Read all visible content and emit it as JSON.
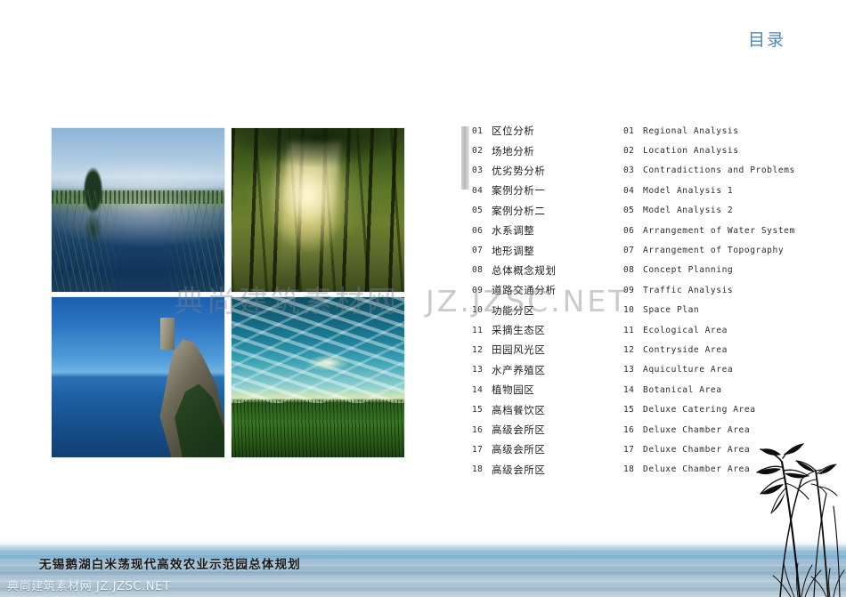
{
  "page": {
    "title_cn": "目录",
    "title_color": "#4e86b4",
    "footer_title": "无锡鹅湖白米荡现代高效农业示范园总体规划"
  },
  "watermark": {
    "center_left": "典尚建筑素材网",
    "center_right": "JZ.JZSC.NET",
    "bottom": "典尚建筑素材网  JZ.JZSC.NET"
  },
  "images": [
    {
      "name": "wetland-pond-photo",
      "caption": "wetland pond at dawn"
    },
    {
      "name": "sunlit-forest-photo",
      "caption": "sunlit forest path"
    },
    {
      "name": "sea-cliff-tower-photo",
      "caption": "sea cliff with stone tower"
    },
    {
      "name": "meadow-sunset-photo",
      "caption": "meadow under dramatic sunset sky"
    }
  ],
  "contents": {
    "chinese": [
      {
        "num": "01",
        "label": "区位分析"
      },
      {
        "num": "02",
        "label": "场地分析"
      },
      {
        "num": "03",
        "label": "优劣势分析"
      },
      {
        "num": "04",
        "label": "案例分析一"
      },
      {
        "num": "05",
        "label": "案例分析二"
      },
      {
        "num": "06",
        "label": "水系调整"
      },
      {
        "num": "07",
        "label": "地形调整"
      },
      {
        "num": "08",
        "label": "总体概念规划"
      },
      {
        "num": "09",
        "label": "道路交通分析"
      },
      {
        "num": "10",
        "label": "功能分区"
      },
      {
        "num": "11",
        "label": "采摘生态区"
      },
      {
        "num": "12",
        "label": "田园风光区"
      },
      {
        "num": "13",
        "label": "水产养殖区"
      },
      {
        "num": "14",
        "label": "植物园区"
      },
      {
        "num": "15",
        "label": "高档餐饮区"
      },
      {
        "num": "16",
        "label": "高级会所区"
      },
      {
        "num": "17",
        "label": "高级会所区"
      },
      {
        "num": "18",
        "label": "高级会所区"
      }
    ],
    "english": [
      {
        "num": "01",
        "label": "Regional Analysis"
      },
      {
        "num": "02",
        "label": "Location Analysis"
      },
      {
        "num": "03",
        "label": "Contradictions and Problems"
      },
      {
        "num": "04",
        "label": "Model Analysis 1"
      },
      {
        "num": "05",
        "label": "Model Analysis 2"
      },
      {
        "num": "06",
        "label": "Arrangement of Water System"
      },
      {
        "num": "07",
        "label": "Arrangement of Topography"
      },
      {
        "num": "08",
        "label": "Concept Planning"
      },
      {
        "num": "09",
        "label": "Traffic Analysis"
      },
      {
        "num": "10",
        "label": "Space Plan"
      },
      {
        "num": "11",
        "label": "Ecological Area"
      },
      {
        "num": "12",
        "label": "Contryside Area"
      },
      {
        "num": "13",
        "label": "Aquiculture Area"
      },
      {
        "num": "14",
        "label": "Botanical Area"
      },
      {
        "num": "15",
        "label": "Deluxe Catering Area"
      },
      {
        "num": "16",
        "label": "Deluxe Chamber Area"
      },
      {
        "num": "17",
        "label": "Deluxe Chamber Area"
      },
      {
        "num": "18",
        "label": "Deluxe Chamber Area"
      }
    ]
  }
}
